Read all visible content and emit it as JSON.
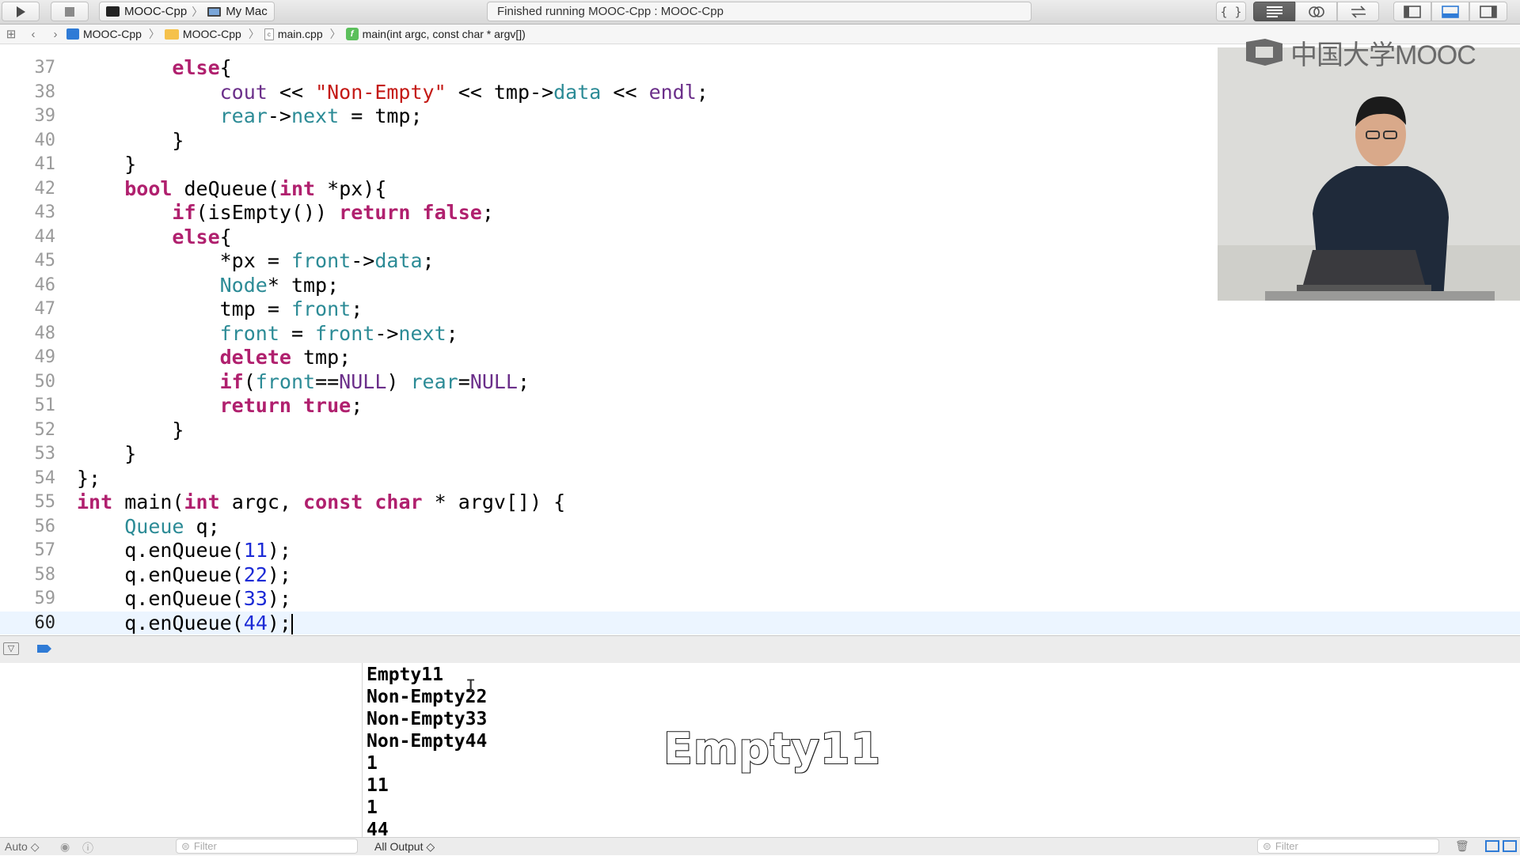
{
  "toolbar": {
    "scheme_target": "MOOC-Cpp",
    "scheme_device": "My Mac",
    "status_text": "Finished running MOOC-Cpp : MOOC-Cpp",
    "braces_label": "{ }"
  },
  "jumpbar": {
    "crumbs": [
      "MOOC-Cpp",
      "MOOC-Cpp",
      "main.cpp",
      "main(int argc, const char * argv[])"
    ]
  },
  "editor": {
    "current_line": "60",
    "lines": [
      {
        "n": "37",
        "text": "        else{"
      },
      {
        "n": "38",
        "text": "            cout << \"Non-Empty\" << tmp->data << endl;"
      },
      {
        "n": "39",
        "text": "            rear->next = tmp;"
      },
      {
        "n": "40",
        "text": "        }"
      },
      {
        "n": "41",
        "text": "    }"
      },
      {
        "n": "42",
        "text": "    bool deQueue(int *px){"
      },
      {
        "n": "43",
        "text": "        if(isEmpty()) return false;"
      },
      {
        "n": "44",
        "text": "        else{"
      },
      {
        "n": "45",
        "text": "            *px = front->data;"
      },
      {
        "n": "46",
        "text": "            Node* tmp;"
      },
      {
        "n": "47",
        "text": "            tmp = front;"
      },
      {
        "n": "48",
        "text": "            front = front->next;"
      },
      {
        "n": "49",
        "text": "            delete tmp;"
      },
      {
        "n": "50",
        "text": "            if(front==NULL) rear=NULL;"
      },
      {
        "n": "51",
        "text": "            return true;"
      },
      {
        "n": "52",
        "text": "        }"
      },
      {
        "n": "53",
        "text": "    }"
      },
      {
        "n": "54",
        "text": "};"
      },
      {
        "n": "55",
        "text": "int main(int argc, const char * argv[]) {"
      },
      {
        "n": "56",
        "text": "    Queue q;"
      },
      {
        "n": "57",
        "text": "    q.enQueue(11);"
      },
      {
        "n": "58",
        "text": "    q.enQueue(22);"
      },
      {
        "n": "59",
        "text": "    q.enQueue(33);"
      },
      {
        "n": "60",
        "text": "    q.enQueue(44);"
      }
    ]
  },
  "video": {
    "logo_text": "中国大学MOOC"
  },
  "console": {
    "output_lines": [
      "Empty11",
      "Non-Empty22",
      "Non-Empty33",
      "Non-Empty44",
      "1",
      "11",
      "1",
      "44"
    ],
    "subtitle": "Empty11"
  },
  "bottombar": {
    "auto_label": "Auto ◇",
    "filter_placeholder": "Filter",
    "output_selector": "All Output ◇"
  },
  "colors": {
    "keyword": "#b0206e",
    "type": "#2c8b96",
    "string": "#c41a16",
    "number": "#1c2bd6",
    "current_line_bg": "#ecf5ff"
  }
}
